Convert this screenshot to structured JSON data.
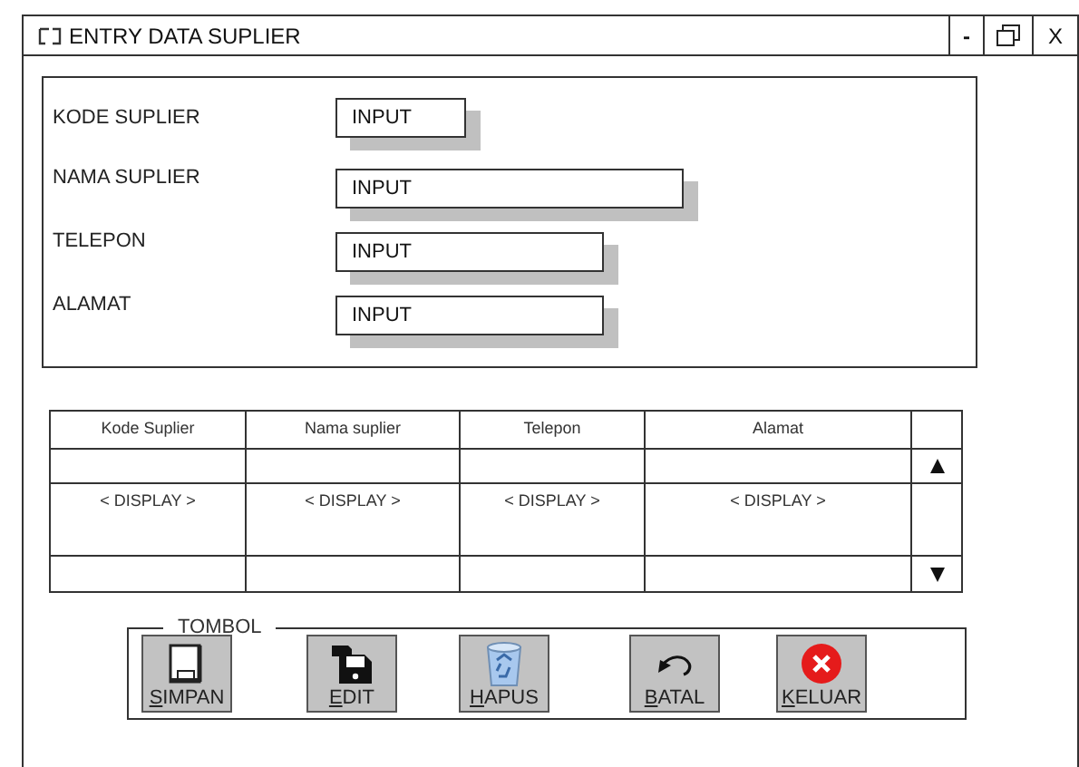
{
  "window": {
    "title": "ENTRY DATA SUPLIER",
    "controls": [
      "-",
      "X"
    ]
  },
  "form": {
    "fields": [
      {
        "label": "KODE SUPLIER",
        "value": "INPUT"
      },
      {
        "label": "NAMA SUPLIER",
        "value": "INPUT"
      },
      {
        "label": "TELEPON",
        "value": "INPUT"
      },
      {
        "label": "ALAMAT",
        "value": "INPUT"
      }
    ]
  },
  "table": {
    "columns": [
      "Kode Suplier",
      "Nama suplier",
      "Telepon",
      "Alamat"
    ],
    "rows": [
      [
        "",
        "",
        "",
        ""
      ],
      [
        "< DISPLAY >",
        "< DISPLAY >",
        "< DISPLAY >",
        "< DISPLAY >"
      ],
      [
        "",
        "",
        "",
        ""
      ]
    ]
  },
  "buttons": {
    "legend": "TOMBOL",
    "items": [
      {
        "label": "SIMPAN",
        "kind": "save"
      },
      {
        "label": "EDIT",
        "kind": "edit"
      },
      {
        "label": "HAPUS",
        "kind": "delete"
      },
      {
        "label": "BATAL",
        "kind": "undo"
      },
      {
        "label": "KELUAR",
        "kind": "exit"
      }
    ]
  }
}
